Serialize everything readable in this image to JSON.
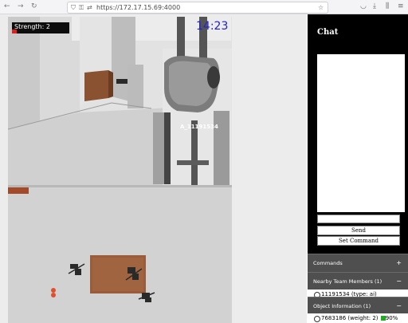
{
  "browser": {
    "url": "https://172.17.15.69:4000",
    "icons": [
      "back-icon",
      "forward-icon",
      "reload-icon",
      "shield-icon",
      "lock-icon",
      "connection-icon",
      "star-icon",
      "pocket-icon",
      "download-icon",
      "library-icon",
      "menu-icon"
    ]
  },
  "hud": {
    "strength_label": "Strength: 2",
    "clock": "14:23",
    "agent_label": "A_11191534"
  },
  "sidebar": {
    "chat_title": "Chat",
    "chat_input_value": "",
    "send_label": "Send",
    "set_command_label": "Set Command",
    "sections": {
      "commands": {
        "label": "Commands",
        "sign": "+"
      },
      "team": {
        "label": "Nearby Team Members (1)",
        "sign": "−"
      },
      "objects": {
        "label": "Object Information (1)",
        "sign": "−"
      }
    },
    "team_members": [
      "11191534 (type: ai)"
    ],
    "objects": [
      {
        "text": "7683186 (weight: 2)",
        "percent": "90%"
      }
    ]
  },
  "colors": {
    "clock": "#2020c8",
    "strength_fill": "#e02020",
    "sidebar_bg": "#000000",
    "accordion_bg": "#4f4f4f",
    "object_status": "#22aa22"
  }
}
